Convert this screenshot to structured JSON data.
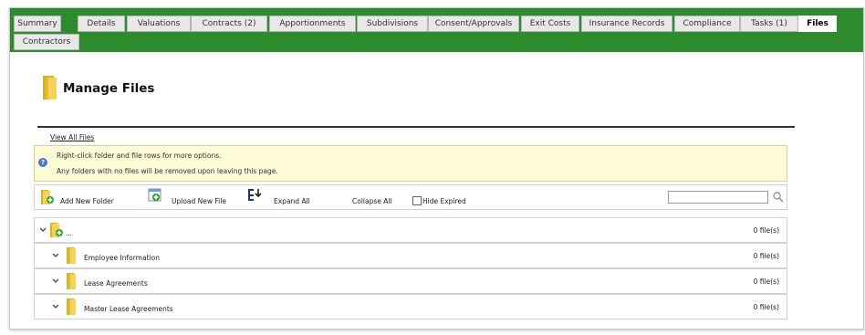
{
  "tabs": [
    {
      "label": "Summary"
    },
    {
      "label": "Details"
    },
    {
      "label": "Valuations"
    },
    {
      "label": "Contracts (2)"
    },
    {
      "label": "Apportionments"
    },
    {
      "label": "Subdivisions"
    },
    {
      "label": "Consent/Approvals"
    },
    {
      "label": "Exit Costs"
    },
    {
      "label": "Insurance Records"
    },
    {
      "label": "Compliance"
    },
    {
      "label": "Tasks (1)"
    },
    {
      "label": "Files",
      "active": true
    },
    {
      "label": "Contractors"
    }
  ],
  "page": {
    "title": "Manage Files",
    "view_all_link": "View All Files"
  },
  "notice": {
    "line1": "Right-click folder and file rows for more options.",
    "line2": "Any folders with no files will be removed upon leaving this page.",
    "icon": "help-icon"
  },
  "toolbar": {
    "add_folder": "Add New Folder",
    "upload_file": "Upload New File",
    "expand_all": "Expand All",
    "collapse_all": "Collapse All",
    "hide_expired": "Hide Expired",
    "hide_expired_checked": false,
    "search_placeholder": "",
    "search_icon": "magnifier-icon"
  },
  "tree": {
    "root": {
      "label": "...",
      "count": "0 file(s)"
    },
    "folders": [
      {
        "label": "Employee Information",
        "count": "0 file(s)"
      },
      {
        "label": "Lease Agreements",
        "count": "0 file(s)"
      },
      {
        "label": "Master Lease Agreements",
        "count": "0 file(s)"
      }
    ]
  },
  "colors": {
    "tabbar_green": "#2e8b2e",
    "notice_bg": "#fdfbd6",
    "folder_yellow": "#e9c53a"
  }
}
